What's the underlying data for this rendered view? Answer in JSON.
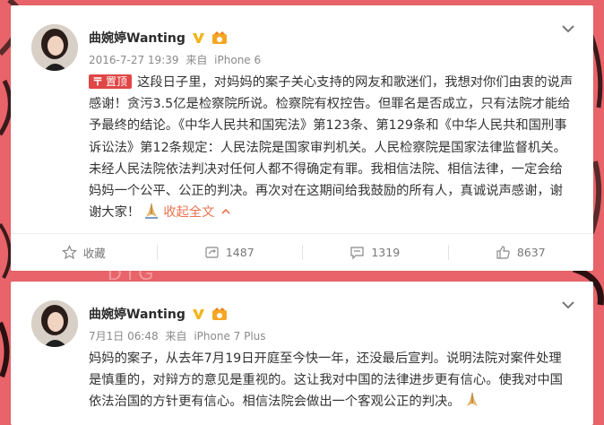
{
  "posts": [
    {
      "username": "曲婉婷Wanting",
      "timestamp": "2016-7-27 19:39",
      "source_prefix": "来自",
      "device": "iPhone 6",
      "pinned_label": "置顶",
      "text": "这段日子里，对妈妈的案子关心支持的网友和歌迷们，我想对你们由衷的说声感谢！贪污3.5亿是检察院所说。检察院有权控告。但罪名是否成立，只有法院才能给予最终的结论。《中华人民共和国宪法》第123条、第129条和《中华人民共和国刑事诉讼法》第12条规定：人民法院是国家审判机关。人民检察院是国家法律监督机关。未经人民法院依法判决对任何人都不得确定有罪。我相信法院、相信法律，一定会给妈妈一个公平、公正的判决。再次对在这期间给我鼓励的所有人，真诚说声感谢，谢谢大家！",
      "collapse_label": "收起全文",
      "actions": {
        "favorite_label": "收藏",
        "repost_count": "1487",
        "comment_count": "1319",
        "like_count": "8637"
      }
    },
    {
      "username": "曲婉婷Wanting",
      "timestamp": "7月1日 06:48",
      "source_prefix": "来自",
      "device": "iPhone 7 Plus",
      "text": "妈妈的案子，从去年7月19日开庭至今快一年，还没最后宣判。说明法院对案件处理是慎重的，对辩方的意见是重视的。这让我对中国的法律进步更有信心。使我对中国依法治国的方针更有信心。相信法院会做出一个客观公正的判决。"
    }
  ],
  "colors": {
    "background": "#e8646a",
    "pin_badge": "#e04646",
    "link_orange": "#eb7350",
    "verified_gold": "#f3b41a"
  },
  "icons": [
    "chevron-down-icon",
    "verified-v-icon",
    "crown-badge-icon",
    "pray-emoji-icon",
    "star-icon",
    "repost-icon",
    "comment-icon",
    "thumbs-up-icon"
  ]
}
